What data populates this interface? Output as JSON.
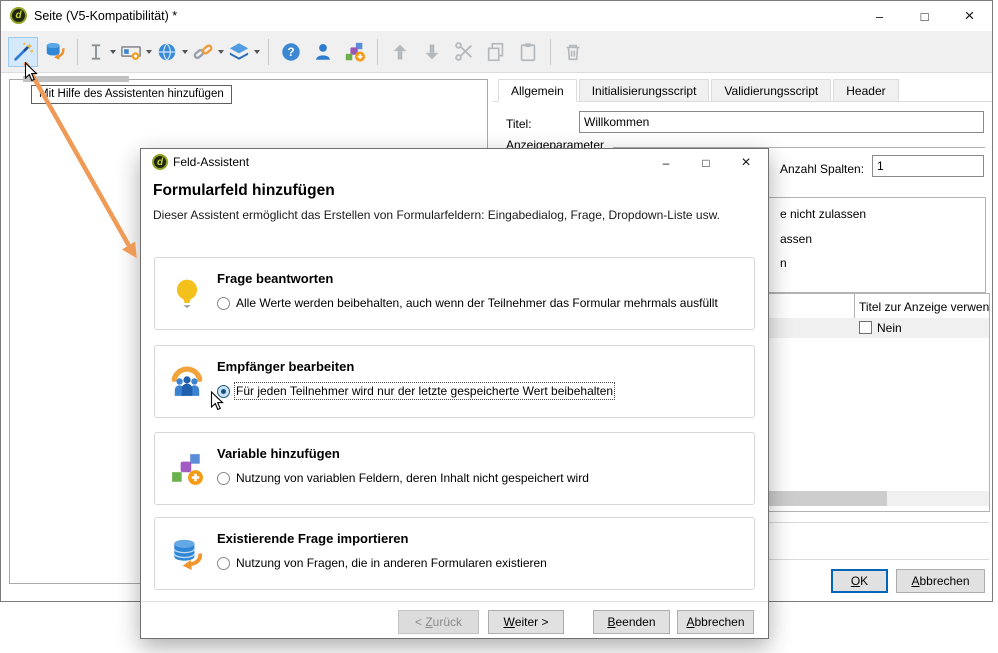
{
  "window": {
    "title": "Seite (V5-Kompatibilität) *",
    "icon_letter": "d",
    "controls": {
      "minimize": "–",
      "maximize": "□",
      "close": "×"
    }
  },
  "toolbar": {
    "tooltip": "Mit Hilfe des Assistenten hinzufügen",
    "icons": [
      "magic-wand",
      "database-undo",
      "text-field",
      "input-dialog",
      "globe",
      "link",
      "layers",
      "help",
      "person",
      "variable-add",
      "move-up",
      "move-down",
      "cut",
      "copy",
      "paste",
      "delete"
    ]
  },
  "workspace": {
    "tabs": [
      "Allgemein",
      "Initialisierungsscript",
      "Validierungsscript",
      "Header"
    ],
    "titel_label": "Titel:",
    "titel_value": "Willkommen",
    "anzeigeparameter_label": "Anzeigeparameter",
    "anzahl_spalten_label": "Anzahl Spalten:",
    "anzahl_spalten_value": "1",
    "clipped_labels": [
      "e nicht zulassen",
      "assen",
      "n"
    ],
    "table": {
      "header": "Titel zur Anzeige verwen",
      "row_label": "Nein"
    },
    "ok_button": {
      "key": "O",
      "post": "K"
    },
    "cancel_button": {
      "key": "A",
      "post": "bbrechen"
    }
  },
  "dialog": {
    "title": "Feld-Assistent",
    "controls": {
      "minimize": "–",
      "maximize": "□",
      "close": "×"
    },
    "heading": "Formularfeld hinzufügen",
    "subtitle": "Dieser Assistent ermöglicht das Erstellen von Formularfeldern: Eingabedialog, Frage, Dropdown-Liste usw.",
    "options": [
      {
        "title": "Frage beantworten",
        "description": "Alle Werte werden beibehalten, auch wenn der Teilnehmer das Formular mehrmals ausfüllt",
        "selected": false
      },
      {
        "title": "Empfänger bearbeiten",
        "description": "Für jeden Teilnehmer wird nur der letzte gespeicherte Wert beibehalten",
        "selected": true
      },
      {
        "title": "Variable hinzufügen",
        "description": "Nutzung von variablen Feldern, deren Inhalt nicht gespeichert wird",
        "selected": false
      },
      {
        "title": "Existierende Frage importieren",
        "description": "Nutzung von Fragen, die in anderen Formularen existieren",
        "selected": false
      }
    ],
    "buttons": {
      "back": {
        "pre": "< ",
        "key": "Z",
        "post": "urück",
        "enabled": false
      },
      "next": {
        "key": "W",
        "post": "eiter >",
        "enabled": true
      },
      "finish": {
        "key": "B",
        "post": "eenden",
        "enabled": true
      },
      "cancel": {
        "key": "A",
        "post": "bbrechen",
        "enabled": true
      }
    }
  },
  "annotation": {
    "arrow_color": "#EF9B58"
  }
}
